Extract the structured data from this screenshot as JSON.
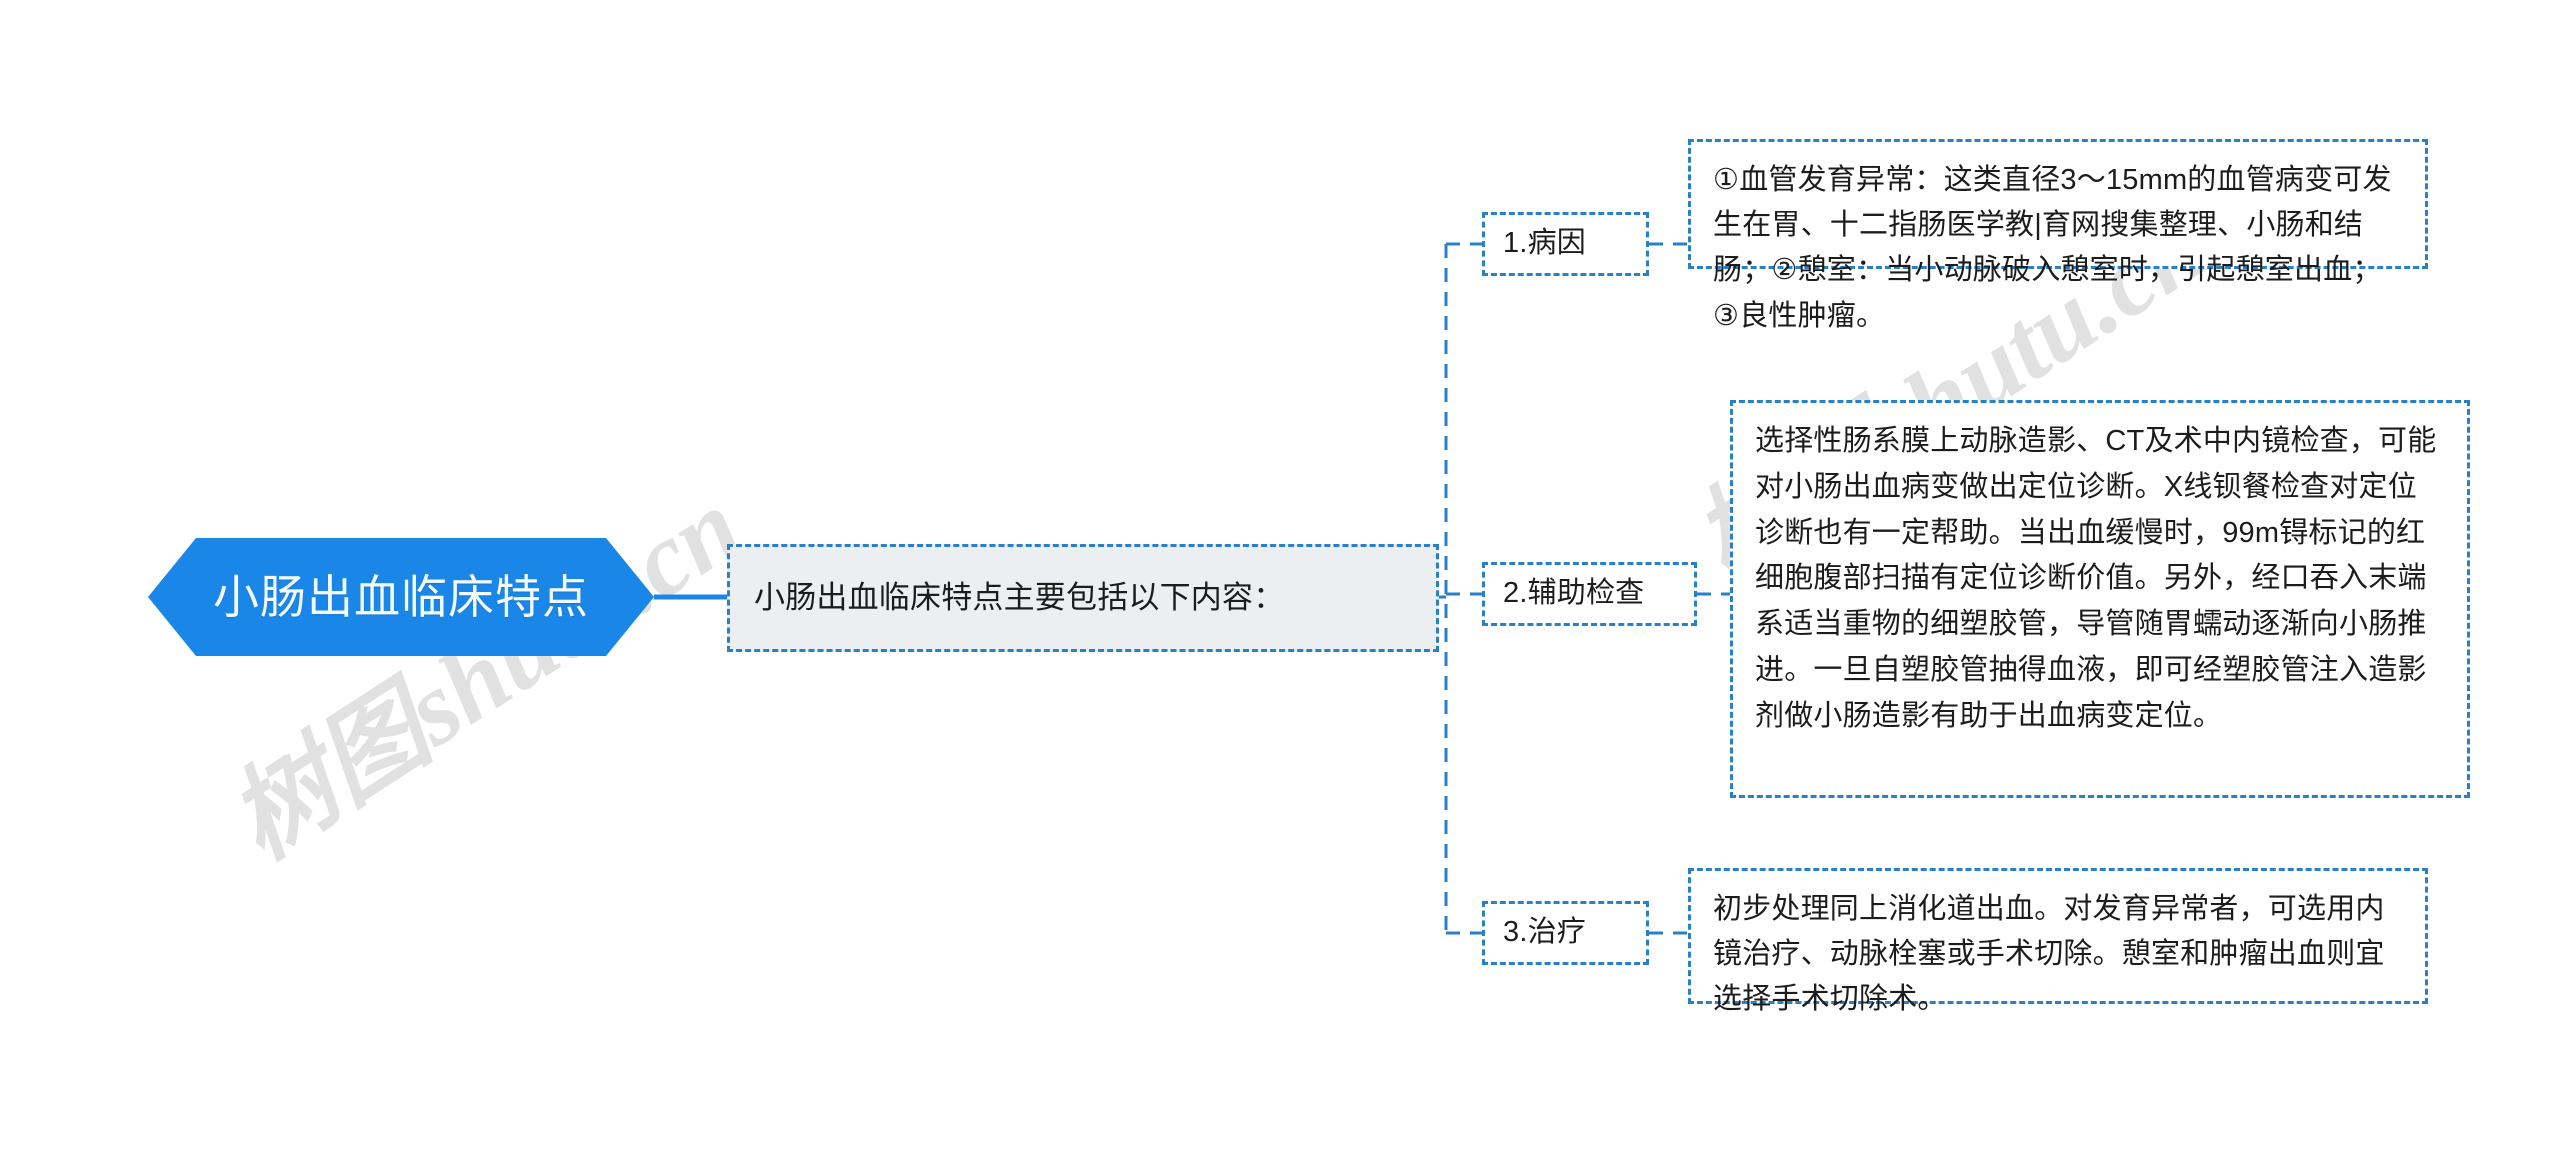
{
  "diagram": {
    "type": "mind-map",
    "orientation": "left-to-right",
    "accent_color": "#1a86e8",
    "border_color": "#2a7fc9",
    "node_fill": "#ebeff2",
    "text_color": "#1c1c1c",
    "root_text_color": "#f4fbff"
  },
  "root": {
    "label": "小肠出血临床特点",
    "shape": "hexagon-banner"
  },
  "summary": {
    "text": "小肠出血临床特点主要包括以下内容："
  },
  "branches": [
    {
      "label": "1.病因",
      "content": "①血管发育异常：这类直径3～15mm的血管病变可发生在胃、十二指肠医学教|育网搜集整理、小肠和结肠；②憩室：当小动脉破入憩室时，引起憩室出血；③良性肿瘤。"
    },
    {
      "label": "2.辅助检查",
      "content": "选择性肠系膜上动脉造影、CT及术中内镜检查，可能对小肠出血病变做出定位诊断。X线钡餐检查对定位诊断也有一定帮助。当出血缓慢时，99m锝标记的红细胞腹部扫描有定位诊断价值。另外，经口吞入末端系适当重物的细塑胶管，导管随胃蠕动逐渐向小肠推进。一旦自塑胶管抽得血液，即可经塑胶管注入造影剂做小肠造影有助于出血病变定位。"
    },
    {
      "label": "3.治疗",
      "content": "初步处理同上消化道出血。对发育异常者，可选用内镜治疗、动脉栓塞或手术切除。憩室和肿瘤出血则宜选择手术切除术。"
    }
  ],
  "watermarks": {
    "left": "树图shutu.cn",
    "right": "树图shutu.cn"
  }
}
